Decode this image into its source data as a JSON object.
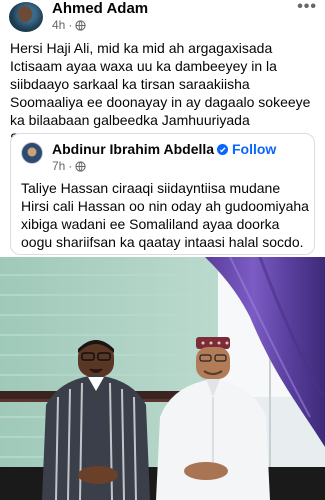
{
  "post": {
    "author": "Ahmed Adam",
    "time": "4h",
    "separator": "·",
    "more_label": "•••",
    "text": "Hersi Haji Ali, mid ka mid ah argagaxisada Ictisaam ayaa waxa uu ka dambeeyey in la siibdaayo sarkaal ka tirsan saraakiisha Soomaaliya ee doonayay in ay dagaalo sokeeye ka bilaabaan galbeedka Jamhuuriyada Somaliland."
  },
  "shared": {
    "author": "Abdinur Ibrahim Abdella",
    "dot": "·",
    "follow_label": "Follow",
    "time": "7h",
    "separator": "·",
    "text": "Taliye Hassan ciraaqi  siidayntiisa  mudane Hirsi cali Hassan oo nin oday ah  gudoomiyaha xibiga wadani  ee Somaliland ayaa doorka oogu shariifsan ka qaatay intaasi halal socdo."
  },
  "icons": {
    "globe": "globe-icon",
    "verified": "verified-badge-icon",
    "more": "more-options-icon"
  },
  "colors": {
    "link_blue": "#0866ff",
    "meta_gray": "#65676b",
    "card_border": "#dadde1"
  }
}
